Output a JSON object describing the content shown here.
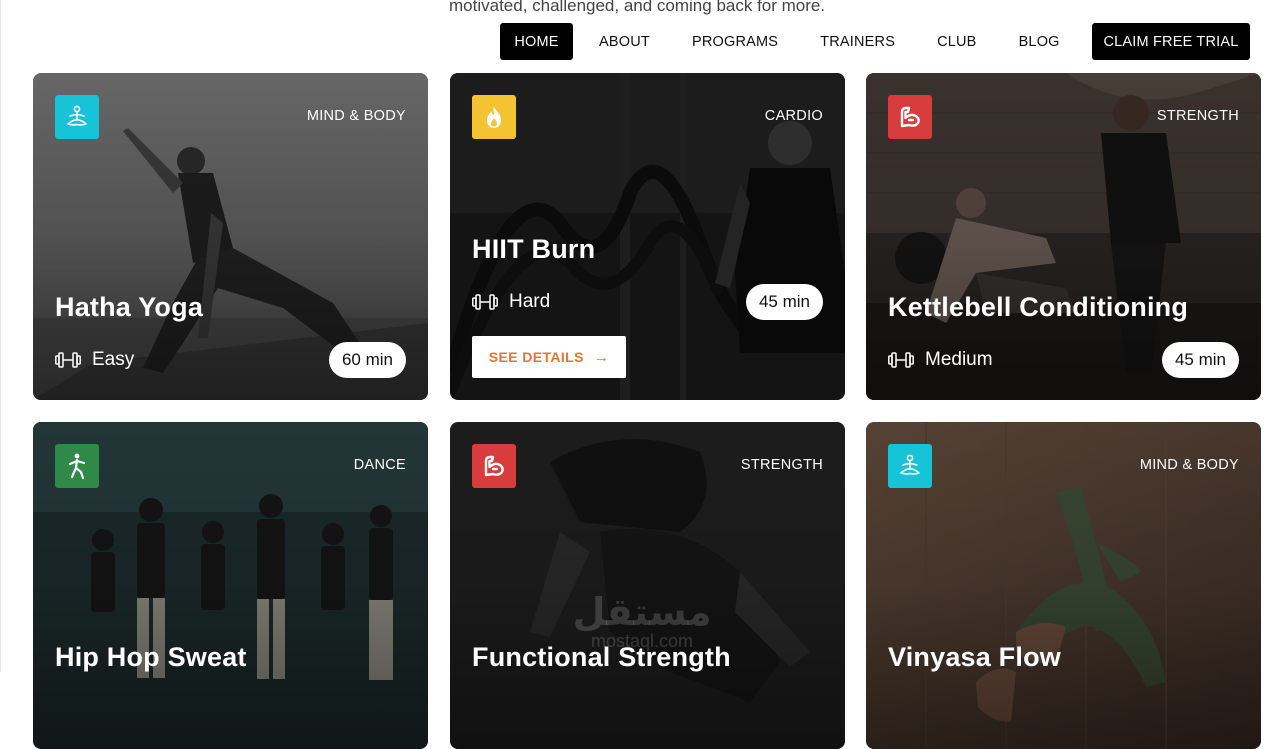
{
  "intro": {
    "text": "motivated, challenged, and coming back for more."
  },
  "nav": {
    "items": [
      {
        "label": "HOME",
        "active": true
      },
      {
        "label": "ABOUT"
      },
      {
        "label": "PROGRAMS"
      },
      {
        "label": "TRAINERS"
      },
      {
        "label": "CLUB"
      },
      {
        "label": "BLOG"
      }
    ],
    "cta": "CLAIM FREE TRIAL"
  },
  "colors": {
    "mind_body": "#17c3d6",
    "cardio": "#f3c332",
    "strength": "#d93c3c",
    "dance": "#2f8a4a",
    "cta_orange": "#e8742e"
  },
  "programs": [
    {
      "category": "MIND & BODY",
      "icon": "meditation-icon",
      "title": "Hatha Yoga",
      "level": "Easy",
      "duration": "60 min"
    },
    {
      "category": "CARDIO",
      "icon": "flame-icon",
      "title": "HIIT Burn",
      "level": "Hard",
      "duration": "45 min",
      "details_label": "SEE DETAILS"
    },
    {
      "category": "STRENGTH",
      "icon": "strength-icon",
      "title": "Kettlebell Conditioning",
      "level": "Medium",
      "duration": "45 min"
    },
    {
      "category": "DANCE",
      "icon": "walking-figure-icon",
      "title": "Hip Hop Sweat"
    },
    {
      "category": "STRENGTH",
      "icon": "strength-icon",
      "title": "Functional Strength"
    },
    {
      "category": "MIND & BODY",
      "icon": "meditation-icon",
      "title": "Vinyasa Flow"
    }
  ],
  "watermark": {
    "arabic": "مستقل",
    "latin": "mostaql.com"
  }
}
